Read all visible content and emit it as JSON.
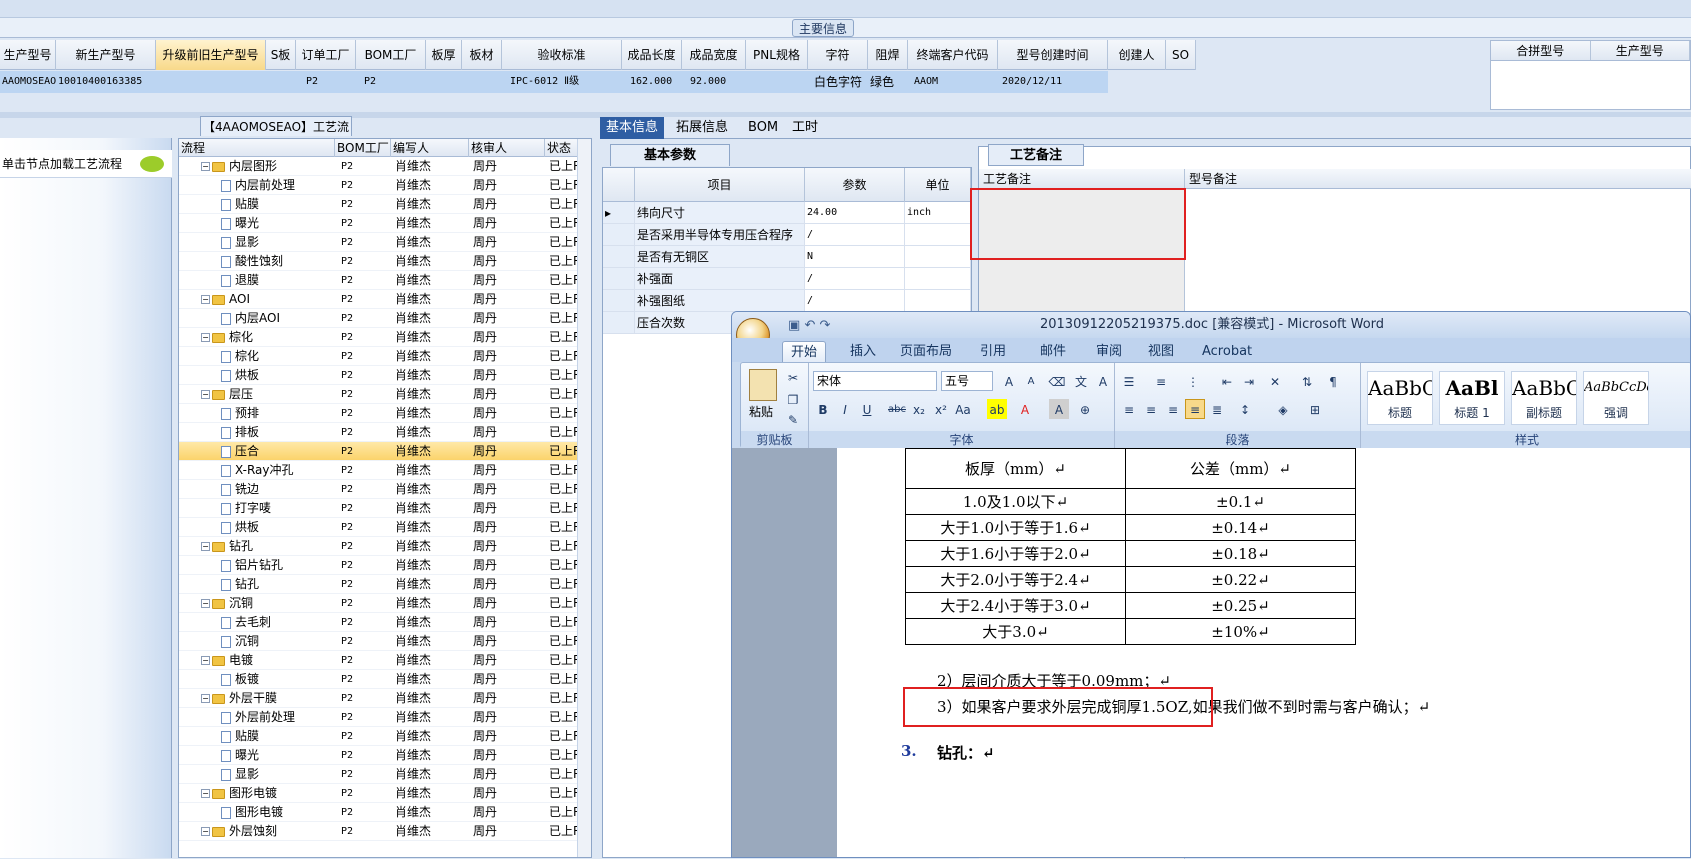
{
  "main_section_title": "主要信息",
  "columns": [
    "生产型号",
    "新生产型号",
    "升级前旧生产型号",
    "S板",
    "订单工厂",
    "BOM工厂",
    "板厚",
    "板材",
    "验收标准",
    "成品长度",
    "成品宽度",
    "PNL规格",
    "字符",
    "阻焊",
    "终端客户代码",
    "型号创建时间",
    "创建人",
    "SO"
  ],
  "row": {
    "prod_model": "AAOMOSEAO",
    "new_model": "10010400163385",
    "order_factory": "P2",
    "bom_factory": "P2",
    "standard": "IPC-6012 Ⅱ级",
    "length": "162.000",
    "width": "92.000",
    "char": "白色字符",
    "solder": "绿色",
    "customer": "AAOM",
    "created": "2020/12/11"
  },
  "right_box": {
    "col1": "合拼型号",
    "col2": "生产型号"
  },
  "left_panel": {
    "tip": "单击节点加载工艺流程"
  },
  "process_title": "【4AAOMOSEAO】工艺流程",
  "tree_headers": [
    "流程",
    "BOM工厂",
    "编写人",
    "核审人",
    "状态"
  ],
  "tree_rows": [
    {
      "level": 0,
      "type": "folder",
      "name": "内层图形",
      "bom": "P2",
      "writer": "肖维杰",
      "reviewer": "周丹",
      "status": "已上R"
    },
    {
      "level": 1,
      "type": "doc",
      "name": "内层前处理",
      "bom": "P2",
      "writer": "肖维杰",
      "reviewer": "周丹",
      "status": "已上R"
    },
    {
      "level": 1,
      "type": "doc",
      "name": "贴膜",
      "bom": "P2",
      "writer": "肖维杰",
      "reviewer": "周丹",
      "status": "已上R"
    },
    {
      "level": 1,
      "type": "doc",
      "name": "曝光",
      "bom": "P2",
      "writer": "肖维杰",
      "reviewer": "周丹",
      "status": "已上R"
    },
    {
      "level": 1,
      "type": "doc",
      "name": "显影",
      "bom": "P2",
      "writer": "肖维杰",
      "reviewer": "周丹",
      "status": "已上R"
    },
    {
      "level": 1,
      "type": "doc",
      "name": "酸性蚀刻",
      "bom": "P2",
      "writer": "肖维杰",
      "reviewer": "周丹",
      "status": "已上R"
    },
    {
      "level": 1,
      "type": "doc",
      "name": "退膜",
      "bom": "P2",
      "writer": "肖维杰",
      "reviewer": "周丹",
      "status": "已上R"
    },
    {
      "level": 0,
      "type": "folder",
      "name": "AOI",
      "bom": "P2",
      "writer": "肖维杰",
      "reviewer": "周丹",
      "status": "已上R"
    },
    {
      "level": 1,
      "type": "doc",
      "name": "内层AOI",
      "bom": "P2",
      "writer": "肖维杰",
      "reviewer": "周丹",
      "status": "已上R"
    },
    {
      "level": 0,
      "type": "folder",
      "name": "棕化",
      "bom": "P2",
      "writer": "肖维杰",
      "reviewer": "周丹",
      "status": "已上R"
    },
    {
      "level": 1,
      "type": "doc",
      "name": "棕化",
      "bom": "P2",
      "writer": "肖维杰",
      "reviewer": "周丹",
      "status": "已上R"
    },
    {
      "level": 1,
      "type": "doc",
      "name": "烘板",
      "bom": "P2",
      "writer": "肖维杰",
      "reviewer": "周丹",
      "status": "已上R"
    },
    {
      "level": 0,
      "type": "folder",
      "name": "层压",
      "bom": "P2",
      "writer": "肖维杰",
      "reviewer": "周丹",
      "status": "已上R"
    },
    {
      "level": 1,
      "type": "doc",
      "name": "预排",
      "bom": "P2",
      "writer": "肖维杰",
      "reviewer": "周丹",
      "status": "已上R"
    },
    {
      "level": 1,
      "type": "doc",
      "name": "排板",
      "bom": "P2",
      "writer": "肖维杰",
      "reviewer": "周丹",
      "status": "已上R"
    },
    {
      "level": 1,
      "type": "doc",
      "name": "压合",
      "bom": "P2",
      "writer": "肖维杰",
      "reviewer": "周丹",
      "status": "已上R",
      "selected": true
    },
    {
      "level": 1,
      "type": "doc",
      "name": "X-Ray冲孔",
      "bom": "P2",
      "writer": "肖维杰",
      "reviewer": "周丹",
      "status": "已上R"
    },
    {
      "level": 1,
      "type": "doc",
      "name": "铣边",
      "bom": "P2",
      "writer": "肖维杰",
      "reviewer": "周丹",
      "status": "已上R"
    },
    {
      "level": 1,
      "type": "doc",
      "name": "打字唛",
      "bom": "P2",
      "writer": "肖维杰",
      "reviewer": "周丹",
      "status": "已上R"
    },
    {
      "level": 1,
      "type": "doc",
      "name": "烘板",
      "bom": "P2",
      "writer": "肖维杰",
      "reviewer": "周丹",
      "status": "已上R"
    },
    {
      "level": 0,
      "type": "folder",
      "name": "钻孔",
      "bom": "P2",
      "writer": "肖维杰",
      "reviewer": "周丹",
      "status": "已上R"
    },
    {
      "level": 1,
      "type": "doc",
      "name": "铝片钻孔",
      "bom": "P2",
      "writer": "肖维杰",
      "reviewer": "周丹",
      "status": "已上R"
    },
    {
      "level": 1,
      "type": "doc",
      "name": "钻孔",
      "bom": "P2",
      "writer": "肖维杰",
      "reviewer": "周丹",
      "status": "已上R"
    },
    {
      "level": 0,
      "type": "folder",
      "name": "沉铜",
      "bom": "P2",
      "writer": "肖维杰",
      "reviewer": "周丹",
      "status": "已上R"
    },
    {
      "level": 1,
      "type": "doc",
      "name": "去毛刺",
      "bom": "P2",
      "writer": "肖维杰",
      "reviewer": "周丹",
      "status": "已上R"
    },
    {
      "level": 1,
      "type": "doc",
      "name": "沉铜",
      "bom": "P2",
      "writer": "肖维杰",
      "reviewer": "周丹",
      "status": "已上R"
    },
    {
      "level": 0,
      "type": "folder",
      "name": "电镀",
      "bom": "P2",
      "writer": "肖维杰",
      "reviewer": "周丹",
      "status": "已上R"
    },
    {
      "level": 1,
      "type": "doc",
      "name": "板镀",
      "bom": "P2",
      "writer": "肖维杰",
      "reviewer": "周丹",
      "status": "已上R"
    },
    {
      "level": 0,
      "type": "folder",
      "name": "外层干膜",
      "bom": "P2",
      "writer": "肖维杰",
      "reviewer": "周丹",
      "status": "已上R"
    },
    {
      "level": 1,
      "type": "doc",
      "name": "外层前处理",
      "bom": "P2",
      "writer": "肖维杰",
      "reviewer": "周丹",
      "status": "已上R"
    },
    {
      "level": 1,
      "type": "doc",
      "name": "贴膜",
      "bom": "P2",
      "writer": "肖维杰",
      "reviewer": "周丹",
      "status": "已上R"
    },
    {
      "level": 1,
      "type": "doc",
      "name": "曝光",
      "bom": "P2",
      "writer": "肖维杰",
      "reviewer": "周丹",
      "status": "已上R"
    },
    {
      "level": 1,
      "type": "doc",
      "name": "显影",
      "bom": "P2",
      "writer": "肖维杰",
      "reviewer": "周丹",
      "status": "已上R"
    },
    {
      "level": 0,
      "type": "folder",
      "name": "图形电镀",
      "bom": "P2",
      "writer": "肖维杰",
      "reviewer": "周丹",
      "status": "已上R"
    },
    {
      "level": 1,
      "type": "doc",
      "name": "图形电镀",
      "bom": "P2",
      "writer": "肖维杰",
      "reviewer": "周丹",
      "status": "已上R"
    },
    {
      "level": 0,
      "type": "folder",
      "name": "外层蚀刻",
      "bom": "P2",
      "writer": "肖维杰",
      "reviewer": "周丹",
      "status": "已上R"
    }
  ],
  "tabs": [
    "基本信息",
    "拓展信息",
    "BOM",
    "工时"
  ],
  "subtab": "基本参数",
  "param_headers": [
    "项目",
    "参数",
    "单位"
  ],
  "params": [
    {
      "item": "纬向尺寸",
      "value": "24.00",
      "unit": "inch"
    },
    {
      "item": "是否采用半导体专用压合程序",
      "value": "/",
      "unit": ""
    },
    {
      "item": "是否有无铜区",
      "value": "N",
      "unit": ""
    },
    {
      "item": "补强面",
      "value": "/",
      "unit": ""
    },
    {
      "item": "补强图纸",
      "value": "/",
      "unit": ""
    },
    {
      "item": "压合次数",
      "value": "",
      "unit": ""
    }
  ],
  "notes_tab": "工艺备注",
  "notes_headers": [
    "工艺备注",
    "型号备注"
  ],
  "word": {
    "title": "20130912205219375.doc [兼容模式] - Microsoft Word",
    "tabs": [
      "开始",
      "插入",
      "页面布局",
      "引用",
      "邮件",
      "审阅",
      "视图",
      "Acrobat"
    ],
    "font_name": "宋体",
    "font_size": "五号",
    "groups": [
      "剪贴板",
      "字体",
      "段落",
      "样式"
    ],
    "paste_label": "粘贴",
    "styles": [
      {
        "preview": "AaBbC",
        "label": "标题"
      },
      {
        "preview": "AaBl",
        "label": "标题 1"
      },
      {
        "preview": "AaBbC",
        "label": "副标题"
      },
      {
        "preview": "AaBbCcDd",
        "label": "强调"
      }
    ],
    "table_headers": [
      "板厚（mm）↵",
      "公差（mm）↵"
    ],
    "table_rows": [
      [
        "1.0及1.0以下↵",
        "±0.1↵"
      ],
      [
        "大于1.0小于等于1.6↵",
        "±0.14↵"
      ],
      [
        "大于1.6小于等于2.0↵",
        "±0.18↵"
      ],
      [
        "大于2.0小于等于2.4↵",
        "±0.22↵"
      ],
      [
        "大于2.4小于等于3.0↵",
        "±0.25↵"
      ],
      [
        "大于3.0↵",
        "±10%↵"
      ]
    ],
    "para2": "2）层间介质大于等于0.09mm；↵",
    "para3": "3）如果客户要求外层完成铜厚1.5OZ,如果我们做不到时需与客户确认；↵",
    "heading_num": "3.",
    "heading": "钻孔：↵"
  }
}
